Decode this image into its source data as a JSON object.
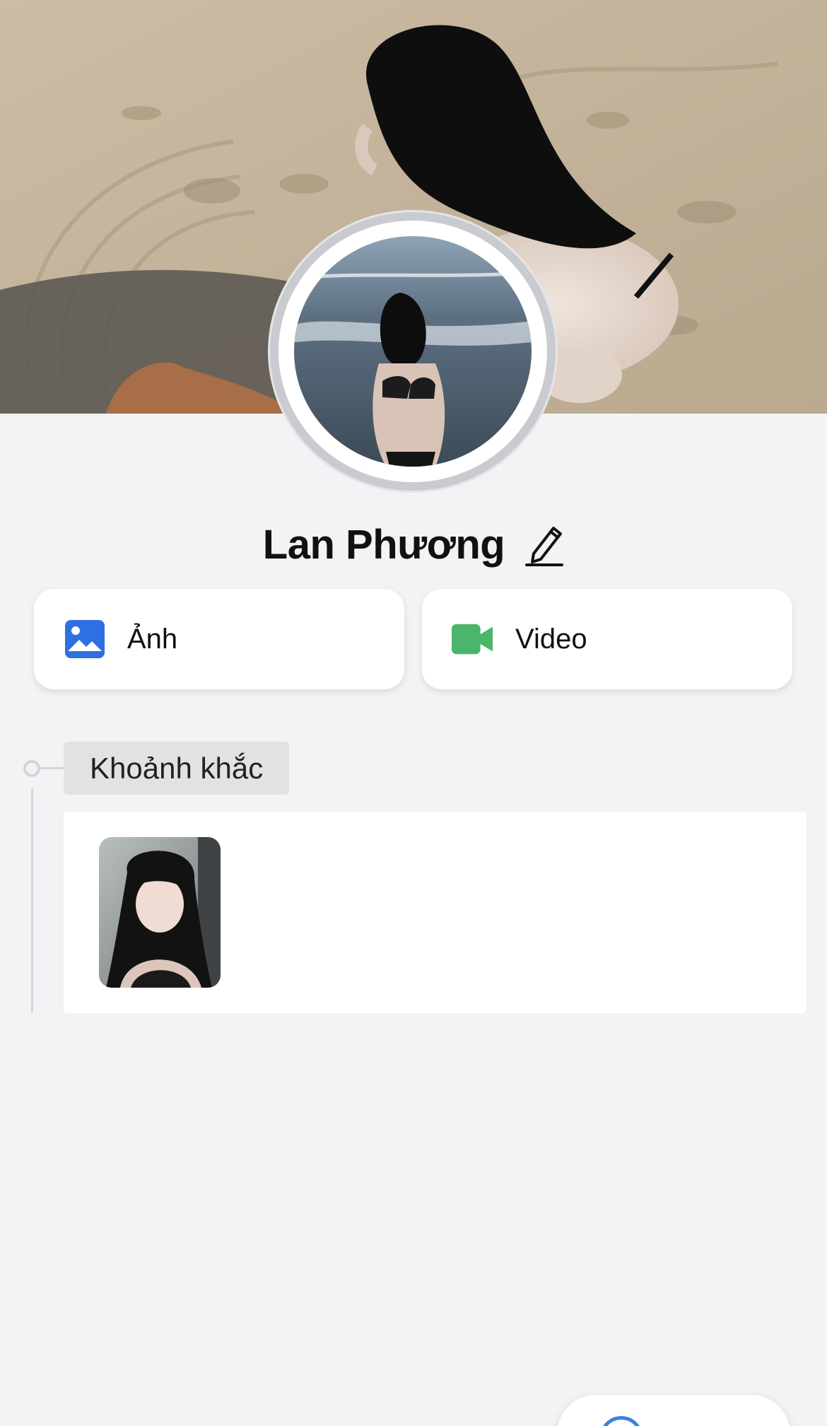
{
  "profile": {
    "name": "Lan Phương",
    "edit_icon": "pencil-icon"
  },
  "media_tabs": {
    "photos": {
      "label": "Ảnh",
      "icon": "image-icon",
      "icon_color": "#2f6fe4"
    },
    "videos": {
      "label": "Video",
      "icon": "video-camera-icon",
      "icon_color": "#4cb56c"
    }
  },
  "timeline": {
    "section_title": "Khoảnh khắc"
  },
  "floating_action": {
    "icon": "circle-icon",
    "label": "",
    "accent": "#3b82e0"
  },
  "colors": {
    "background": "#f2f3f5",
    "card": "#ffffff",
    "chip": "#e1e2e4",
    "avatar_ring": "#c9cbd0"
  }
}
